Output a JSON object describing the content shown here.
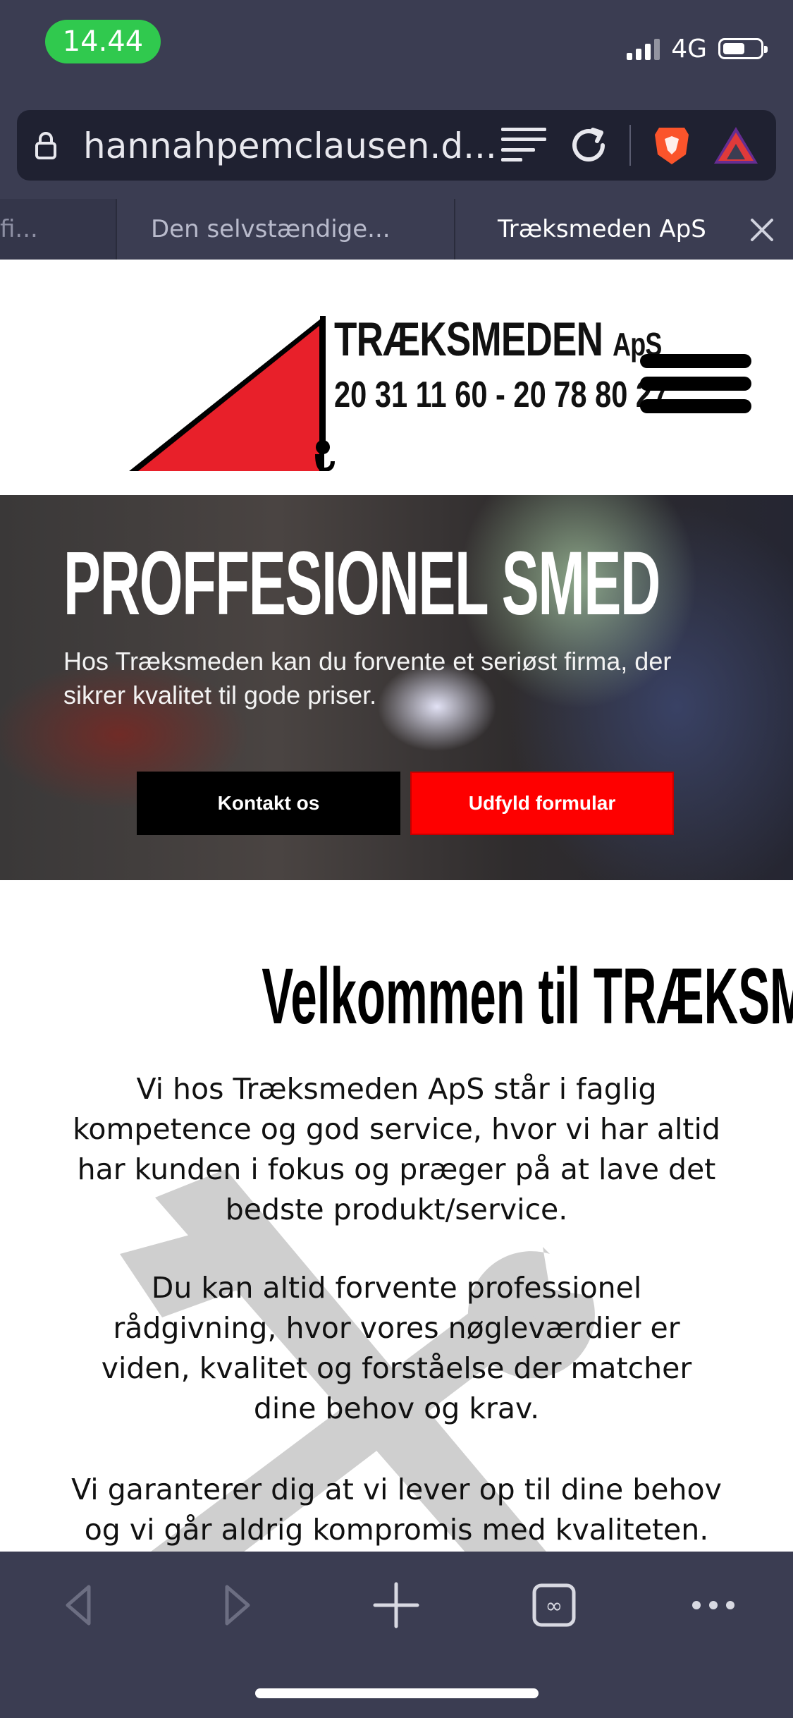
{
  "status_bar": {
    "time": "14.44",
    "network": "4G"
  },
  "browser": {
    "url": "hannahpemclausen.d...",
    "tabs": [
      {
        "label": "fi..."
      },
      {
        "label": "Den selvstændige..."
      },
      {
        "label": "Træksmeden ApS"
      }
    ]
  },
  "site": {
    "brand_main": "TRÆKSMEDEN",
    "brand_suffix": "ApS",
    "phones": "20 31 11 60 - 20 78 80 27"
  },
  "hero": {
    "title": "PROFFESIONEL SMED",
    "subtitle": "Hos Træksmeden kan du forvente et seriøst firma, der sikrer kvalitet til gode priser.",
    "btn_contact": "Kontakt os",
    "btn_form": "Udfyld formular"
  },
  "welcome": {
    "title": "Velkommen til TRÆKSMEDEN ApS",
    "p1": "Vi hos Træksmeden ApS står i faglig kompetence og god service, hvor vi har altid har kunden i fokus og præger på at lave det bedste produkt/service.",
    "p2": "Du kan altid forvente professionel rådgivning, hvor vores nøgleværdier er viden, kvalitet og forståelse der matcher dine behov og krav.",
    "p3": "Vi garanterer dig at vi lever op til dine behov og vi går aldrig kompromis med kvaliteten."
  },
  "colors": {
    "brand_red": "#fe0000",
    "chrome": "#3b3d52",
    "status_green": "#30c94e"
  }
}
